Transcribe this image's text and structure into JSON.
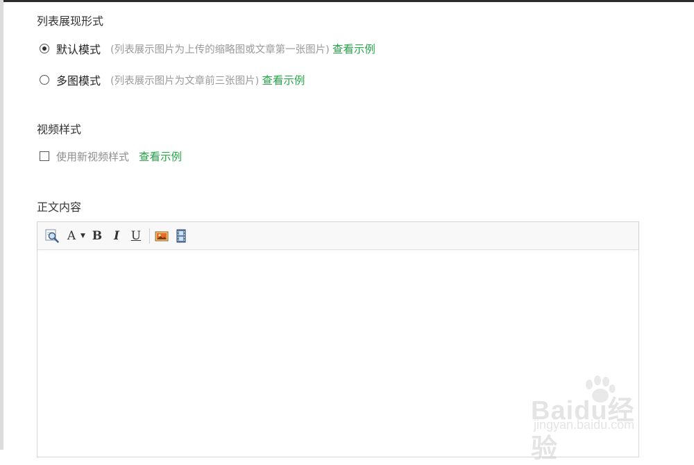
{
  "list_display": {
    "title": "列表展现形式",
    "options": [
      {
        "label": "默认模式",
        "desc": "(列表展示图片为上传的缩略图或文章第一张图片)",
        "link": "查看示例",
        "selected": true
      },
      {
        "label": "多图模式",
        "desc": "(列表展示图片为文章前三张图片)",
        "link": "查看示例",
        "selected": false
      }
    ]
  },
  "video_style": {
    "title": "视频样式",
    "checkbox_label": "使用新视频样式",
    "link": "查看示例",
    "checked": false
  },
  "body_content": {
    "title": "正文内容",
    "toolbar": [
      {
        "name": "preview-icon",
        "type": "icon"
      },
      {
        "name": "font-dropdown",
        "type": "text",
        "text": "A"
      },
      {
        "name": "bold-button",
        "type": "text",
        "text": "B"
      },
      {
        "name": "italic-button",
        "type": "text",
        "text": "I"
      },
      {
        "name": "underline-button",
        "type": "text",
        "text": "U"
      },
      {
        "name": "insert-image-icon",
        "type": "icon"
      },
      {
        "name": "insert-video-icon",
        "type": "icon"
      }
    ]
  },
  "watermark": {
    "brand": "Baidu经验",
    "url": "jingyan.baidu.com"
  },
  "colors": {
    "link_green": "#25a847",
    "muted_gray": "#9a9a9a",
    "border": "#d6d6d6"
  }
}
